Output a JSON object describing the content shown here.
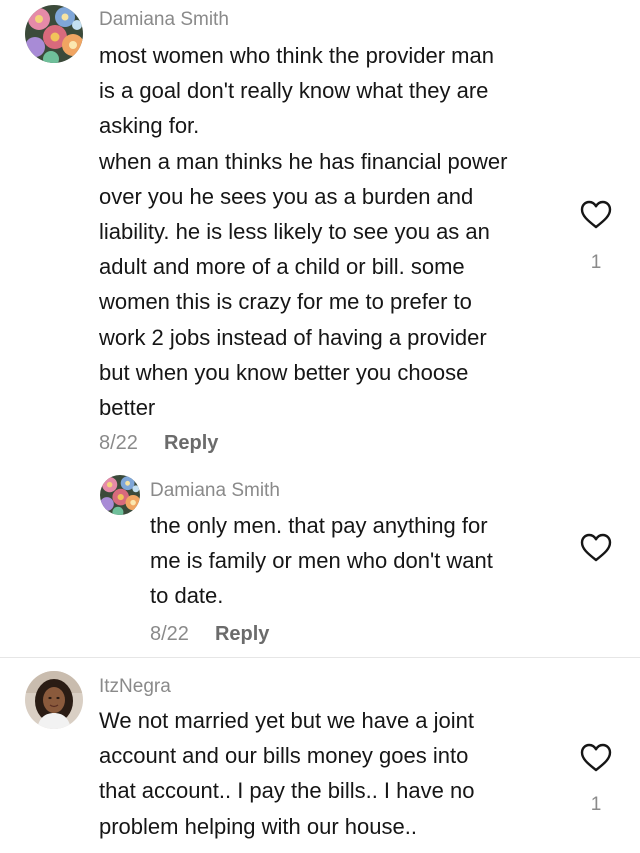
{
  "comments": [
    {
      "username": "Damiana Smith",
      "avatar": "floral-avatar",
      "lines": [
        "most women who think the provider man",
        "is a goal don't really know what they are",
        "asking for.",
        "when a man thinks he has financial power",
        "over you he sees you as a burden and",
        "liability. he is less likely to see you as an",
        "adult and more of a child or bill. some",
        "women this is crazy for me to prefer to",
        "work 2 jobs instead of having a provider",
        "but when you know better you choose",
        "better"
      ],
      "date": "8/22",
      "reply_label": "Reply",
      "like_count": "1"
    },
    {
      "username": "Damiana Smith",
      "avatar": "floral-avatar",
      "lines": [
        "the only men. that pay anything for",
        "me is family or men who don't want",
        "to date."
      ],
      "date": "8/22",
      "reply_label": "Reply",
      "like_count": ""
    },
    {
      "username": "ItzNegra",
      "avatar": "profile-photo-avatar",
      "lines": [
        "We not married yet but we have a joint",
        "account and our bills money goes into",
        "that account.. I pay the bills.. I have no",
        "problem helping with our house.."
      ],
      "like_count": "1"
    }
  ],
  "colors": {
    "text": "#161616",
    "muted": "#8a8a8a",
    "divider": "#e6e6e6"
  }
}
